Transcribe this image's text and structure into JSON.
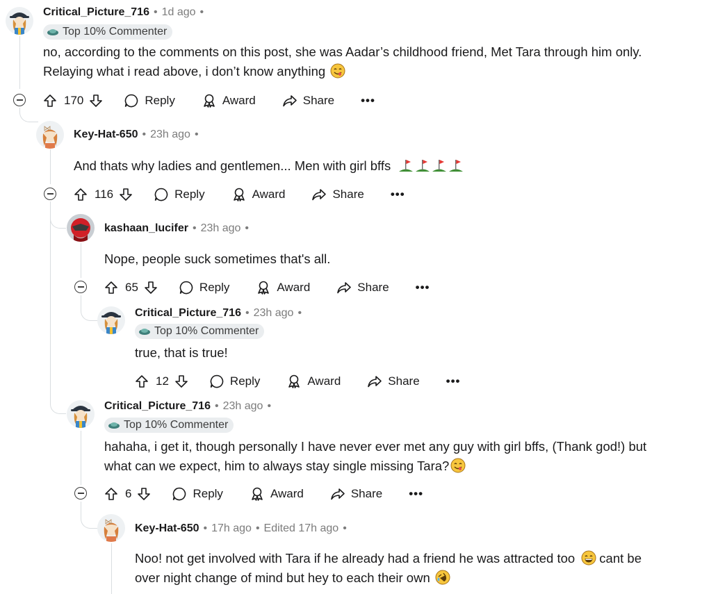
{
  "comments": [
    {
      "author": "Critical_Picture_716",
      "time": "1d ago",
      "flair": "Top 10% Commenter",
      "lines": [
        "no, according to the comments on this post, she was Aadar’s childhood friend, Met Tara through him only.",
        "Relaying what i read above, i don’t know anything"
      ],
      "votes": "170"
    },
    {
      "author": "Key-Hat-650",
      "time": "23h ago",
      "lines": [
        "And thats why ladies and gentlemen... Men with girl bffs"
      ],
      "votes": "116"
    },
    {
      "author": "kashaan_lucifer",
      "time": "23h ago",
      "lines": [
        "Nope, people suck sometimes that's all."
      ],
      "votes": "65"
    },
    {
      "author": "Critical_Picture_716",
      "time": "23h ago",
      "flair": "Top 10% Commenter",
      "lines": [
        "true, that is true!"
      ],
      "votes": "12"
    },
    {
      "author": "Critical_Picture_716",
      "time": "23h ago",
      "flair": "Top 10% Commenter",
      "lines": [
        "hahaha, i get it, though personally I have never ever met any guy with girl bffs, (Thank god!) but",
        "what can we expect, him to always stay single missing Tara?"
      ],
      "votes": "6"
    },
    {
      "author": "Key-Hat-650",
      "time": "17h ago",
      "edited": "Edited 17h ago",
      "lines": [
        "Noo! not get involved with Tara if he already had a friend he was attracted too",
        "over night change of mind but hey to each their own"
      ],
      "line2_suffix": "cant be"
    }
  ],
  "actions": {
    "reply": "Reply",
    "award": "Award",
    "share": "Share",
    "more": "•••"
  },
  "icons": [
    "upvote-icon",
    "downvote-icon",
    "reply-bubble-icon",
    "award-icon",
    "share-icon",
    "more-icon",
    "collapse-icon"
  ],
  "colors": {
    "text": "#1a1a1b",
    "meta": "#7c7c7c",
    "flair_bg": "#eaedef",
    "thread": "#d9dde0"
  }
}
